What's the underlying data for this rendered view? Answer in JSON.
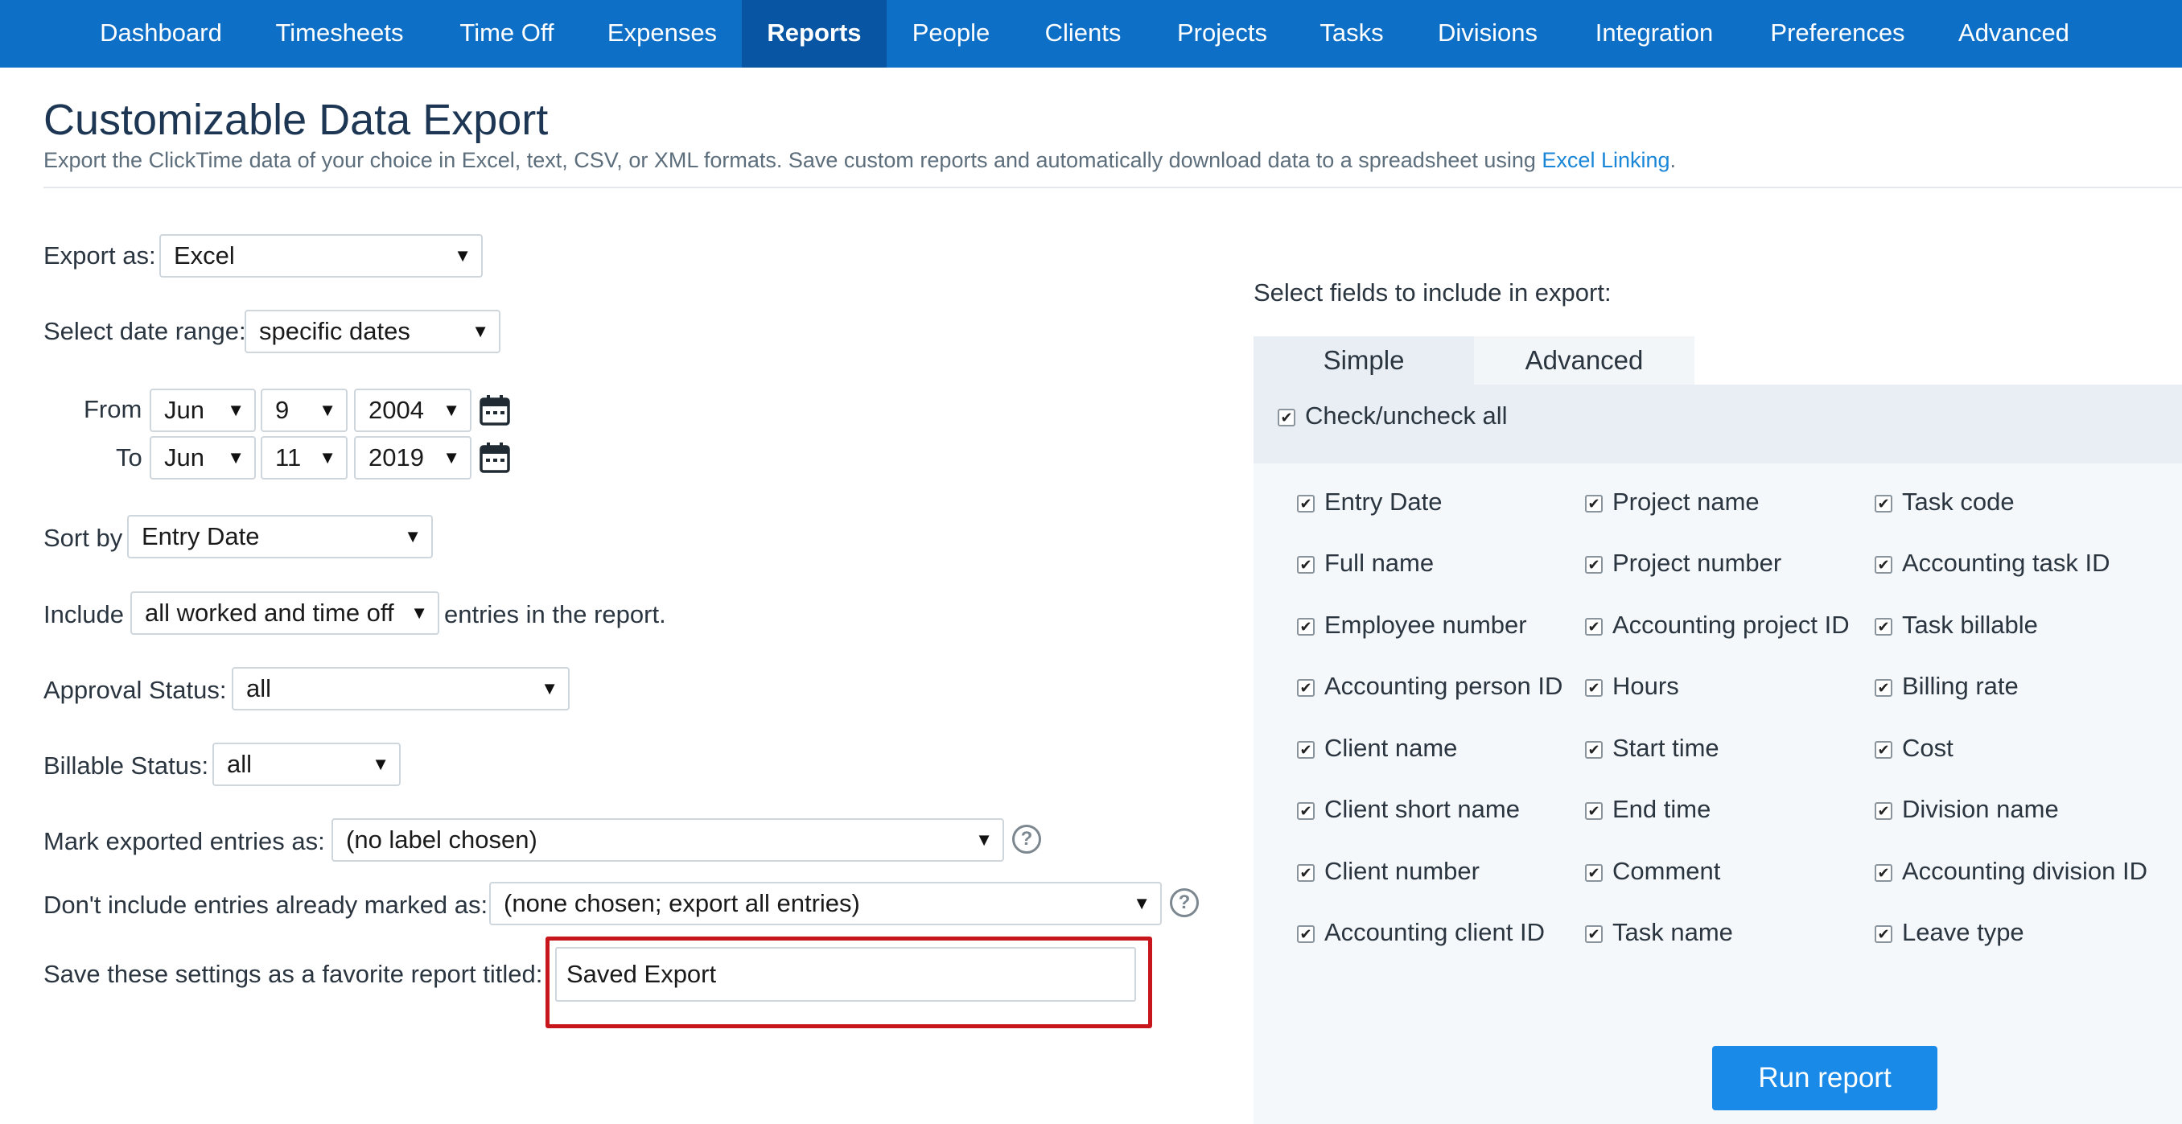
{
  "nav": {
    "items": [
      {
        "label": "Dashboard"
      },
      {
        "label": "Timesheets"
      },
      {
        "label": "Time Off"
      },
      {
        "label": "Expenses"
      },
      {
        "label": "Reports"
      },
      {
        "label": "People"
      },
      {
        "label": "Clients"
      },
      {
        "label": "Projects"
      },
      {
        "label": "Tasks"
      },
      {
        "label": "Divisions"
      },
      {
        "label": "Integration"
      },
      {
        "label": "Preferences"
      },
      {
        "label": "Advanced"
      }
    ],
    "active": "Reports"
  },
  "header": {
    "title": "Customizable Data Export",
    "description": "Export the ClickTime data of your choice in Excel, text, CSV, or XML formats. Save custom reports and automatically download data to a spreadsheet using ",
    "link_text": "Excel Linking",
    "period": "."
  },
  "form": {
    "export_as": {
      "label": "Export as:",
      "value": "Excel"
    },
    "date_range": {
      "label": "Select date range:",
      "value": "specific dates"
    },
    "from": {
      "label": "From",
      "month": "Jun",
      "day": "9",
      "year": "2004"
    },
    "to": {
      "label": "To",
      "month": "Jun",
      "day": "11",
      "year": "2019"
    },
    "sort_by": {
      "label": "Sort by",
      "value": "Entry Date"
    },
    "include": {
      "label": "Include",
      "value": "all worked and time off",
      "suffix": "entries in the report."
    },
    "approval_status": {
      "label": "Approval Status:",
      "value": "all"
    },
    "billable_status": {
      "label": "Billable Status:",
      "value": "all"
    },
    "mark_exported": {
      "label": "Mark exported entries as:",
      "value": "(no label chosen)"
    },
    "dont_include": {
      "label": "Don't include entries already marked as:",
      "value": "(none chosen; export all entries)"
    },
    "save_as": {
      "label": "Save these settings as a favorite report titled:",
      "value": "Saved Export"
    }
  },
  "fields_panel": {
    "heading": "Select fields to include in export:",
    "tabs": {
      "simple": "Simple",
      "advanced": "Advanced"
    },
    "active_tab": "Simple",
    "check_all": {
      "label": "Check/uncheck all",
      "checked": true
    },
    "columns": [
      [
        {
          "label": "Entry Date",
          "checked": true
        },
        {
          "label": "Full name",
          "checked": true
        },
        {
          "label": "Employee number",
          "checked": true
        },
        {
          "label": "Accounting person ID",
          "checked": true
        },
        {
          "label": "Client name",
          "checked": true
        },
        {
          "label": "Client short name",
          "checked": true
        },
        {
          "label": "Client number",
          "checked": true
        },
        {
          "label": "Accounting client ID",
          "checked": true
        }
      ],
      [
        {
          "label": "Project name",
          "checked": true
        },
        {
          "label": "Project number",
          "checked": true
        },
        {
          "label": "Accounting project ID",
          "checked": true
        },
        {
          "label": "Hours",
          "checked": true
        },
        {
          "label": "Start time",
          "checked": true
        },
        {
          "label": "End time",
          "checked": true
        },
        {
          "label": "Comment",
          "checked": true
        },
        {
          "label": "Task name",
          "checked": true
        }
      ],
      [
        {
          "label": "Task code",
          "checked": true
        },
        {
          "label": "Accounting task ID",
          "checked": true
        },
        {
          "label": "Task billable",
          "checked": true
        },
        {
          "label": "Billing rate",
          "checked": true
        },
        {
          "label": "Cost",
          "checked": true
        },
        {
          "label": "Division name",
          "checked": true
        },
        {
          "label": "Accounting division ID",
          "checked": true
        },
        {
          "label": "Leave type",
          "checked": true
        }
      ]
    ],
    "run_button": "Run report"
  },
  "icons": {
    "calendar": "calendar-icon",
    "help": "help-icon",
    "check": "checkmark-icon",
    "dropdown": "caret-down-icon"
  },
  "colors": {
    "nav_bg": "#0e6fc7",
    "nav_active": "#0856a3",
    "link": "#1a86d8",
    "primary_button": "#1a8ae8",
    "highlight": "#c8161d"
  }
}
